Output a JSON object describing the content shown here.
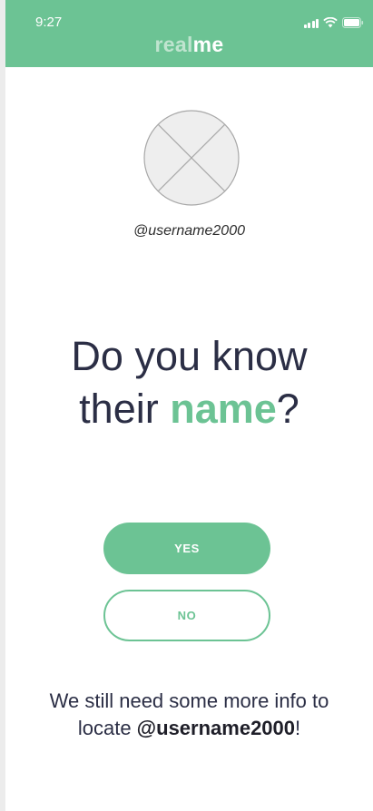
{
  "status_bar": {
    "time": "9:27"
  },
  "header": {
    "logo_light": "real",
    "logo_bold": "me"
  },
  "profile": {
    "username": "@username2000"
  },
  "question": {
    "line1": "Do you know",
    "line2_prefix": "their ",
    "line2_accent": "name",
    "line2_suffix": "?"
  },
  "actions": {
    "yes_label": "YES",
    "no_label": "NO"
  },
  "footer": {
    "line1": "We still need some more info to",
    "line2_prefix": "locate ",
    "line2_username": "@username2000",
    "line2_suffix": "!"
  },
  "colors": {
    "accent": "#6cc394",
    "text": "#2b2e45",
    "background": "#ffffff"
  },
  "icons": {
    "avatar": "placeholder-image-icon",
    "signal": "cellular-signal-icon",
    "wifi": "wifi-icon",
    "battery": "battery-icon"
  }
}
